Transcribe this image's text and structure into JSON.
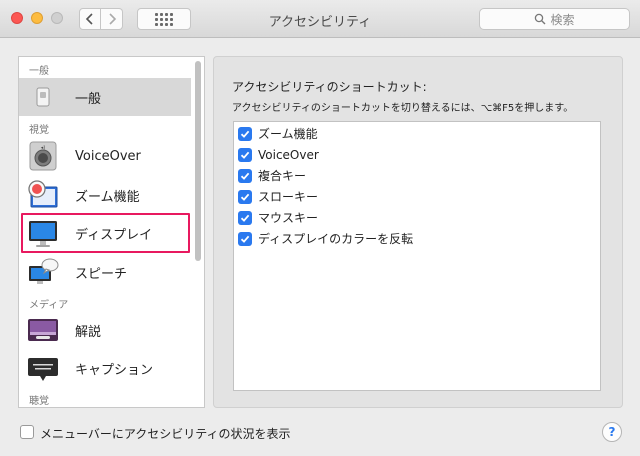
{
  "window": {
    "title": "アクセシビリティ",
    "search_placeholder": "検索"
  },
  "sidebar": {
    "sections": [
      {
        "label": "一般"
      },
      {
        "label": "視覚"
      },
      {
        "label": "メディア"
      },
      {
        "label": "聴覚"
      }
    ],
    "items": [
      {
        "label": "一般",
        "icon": "general-icon",
        "selected": true
      },
      {
        "label": "VoiceOver",
        "icon": "voiceover-icon"
      },
      {
        "label": "ズーム機能",
        "icon": "zoom-icon"
      },
      {
        "label": "ディスプレイ",
        "icon": "display-icon",
        "highlighted": true
      },
      {
        "label": "スピーチ",
        "icon": "speech-icon"
      },
      {
        "label": "解説",
        "icon": "descriptions-icon"
      },
      {
        "label": "キャプション",
        "icon": "captions-icon"
      }
    ]
  },
  "panel": {
    "title": "アクセシビリティのショートカット:",
    "description": "アクセシビリティのショートカットを切り替えるには、⌥⌘F5を押します。",
    "options": [
      {
        "label": "ズーム機能",
        "checked": true
      },
      {
        "label": "VoiceOver",
        "checked": true
      },
      {
        "label": "複合キー",
        "checked": true
      },
      {
        "label": "スローキー",
        "checked": true
      },
      {
        "label": "マウスキー",
        "checked": true
      },
      {
        "label": "ディスプレイのカラーを反転",
        "checked": true
      }
    ]
  },
  "bottom": {
    "menubar_status_label": "メニューバーにアクセシビリティの状況を表示",
    "menubar_status_checked": false,
    "help_label": "?"
  },
  "colors": {
    "highlight": "#e8195f",
    "checkbox": "#2a79ef"
  }
}
